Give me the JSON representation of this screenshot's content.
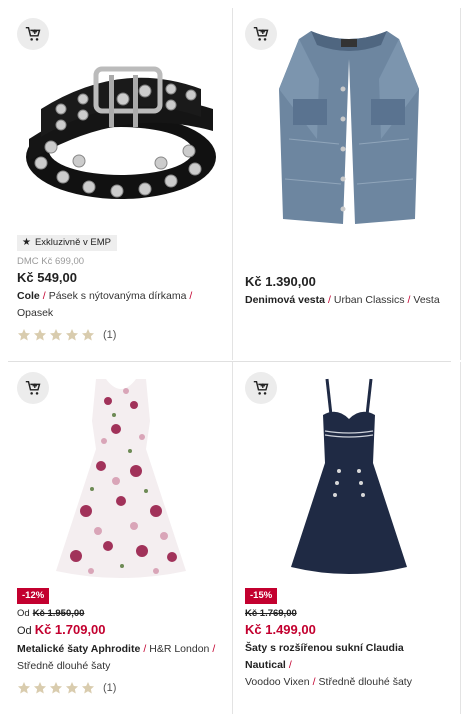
{
  "products": [
    {
      "exclusive_label": "Exkluzivně v EMP",
      "dmc": "DMC Kč 699,00",
      "price": "Kč 549,00",
      "brand": "Cole",
      "name": "Pásek s nýtovanýma dírkama",
      "category": "Opasek",
      "rating_count": "(1)",
      "rating_value": 5
    },
    {
      "price": "Kč 1.390,00",
      "brand": "Denimová vesta",
      "name": "Urban Classics",
      "category": "Vesta"
    },
    {
      "discount": "-12%",
      "old_prefix": "Od",
      "old_price": "Kč 1.950,00",
      "price_prefix": "Od",
      "price": "Kč 1.709,00",
      "brand": "Metalické šaty Aphrodite",
      "name": "H&R London",
      "category": "Středně dlouhé šaty",
      "rating_count": "(1)",
      "rating_value": 5
    },
    {
      "discount": "-15%",
      "old_price": "Kč 1.769,00",
      "price": "Kč 1.499,00",
      "brand": "Šaty s rozšířenou sukní Claudia Nautical",
      "name": "Voodoo Vixen",
      "category": "Středně dlouhé šaty"
    }
  ],
  "separator": "/",
  "colors": {
    "accent": "#c3002f",
    "star": "#d9ccae"
  }
}
